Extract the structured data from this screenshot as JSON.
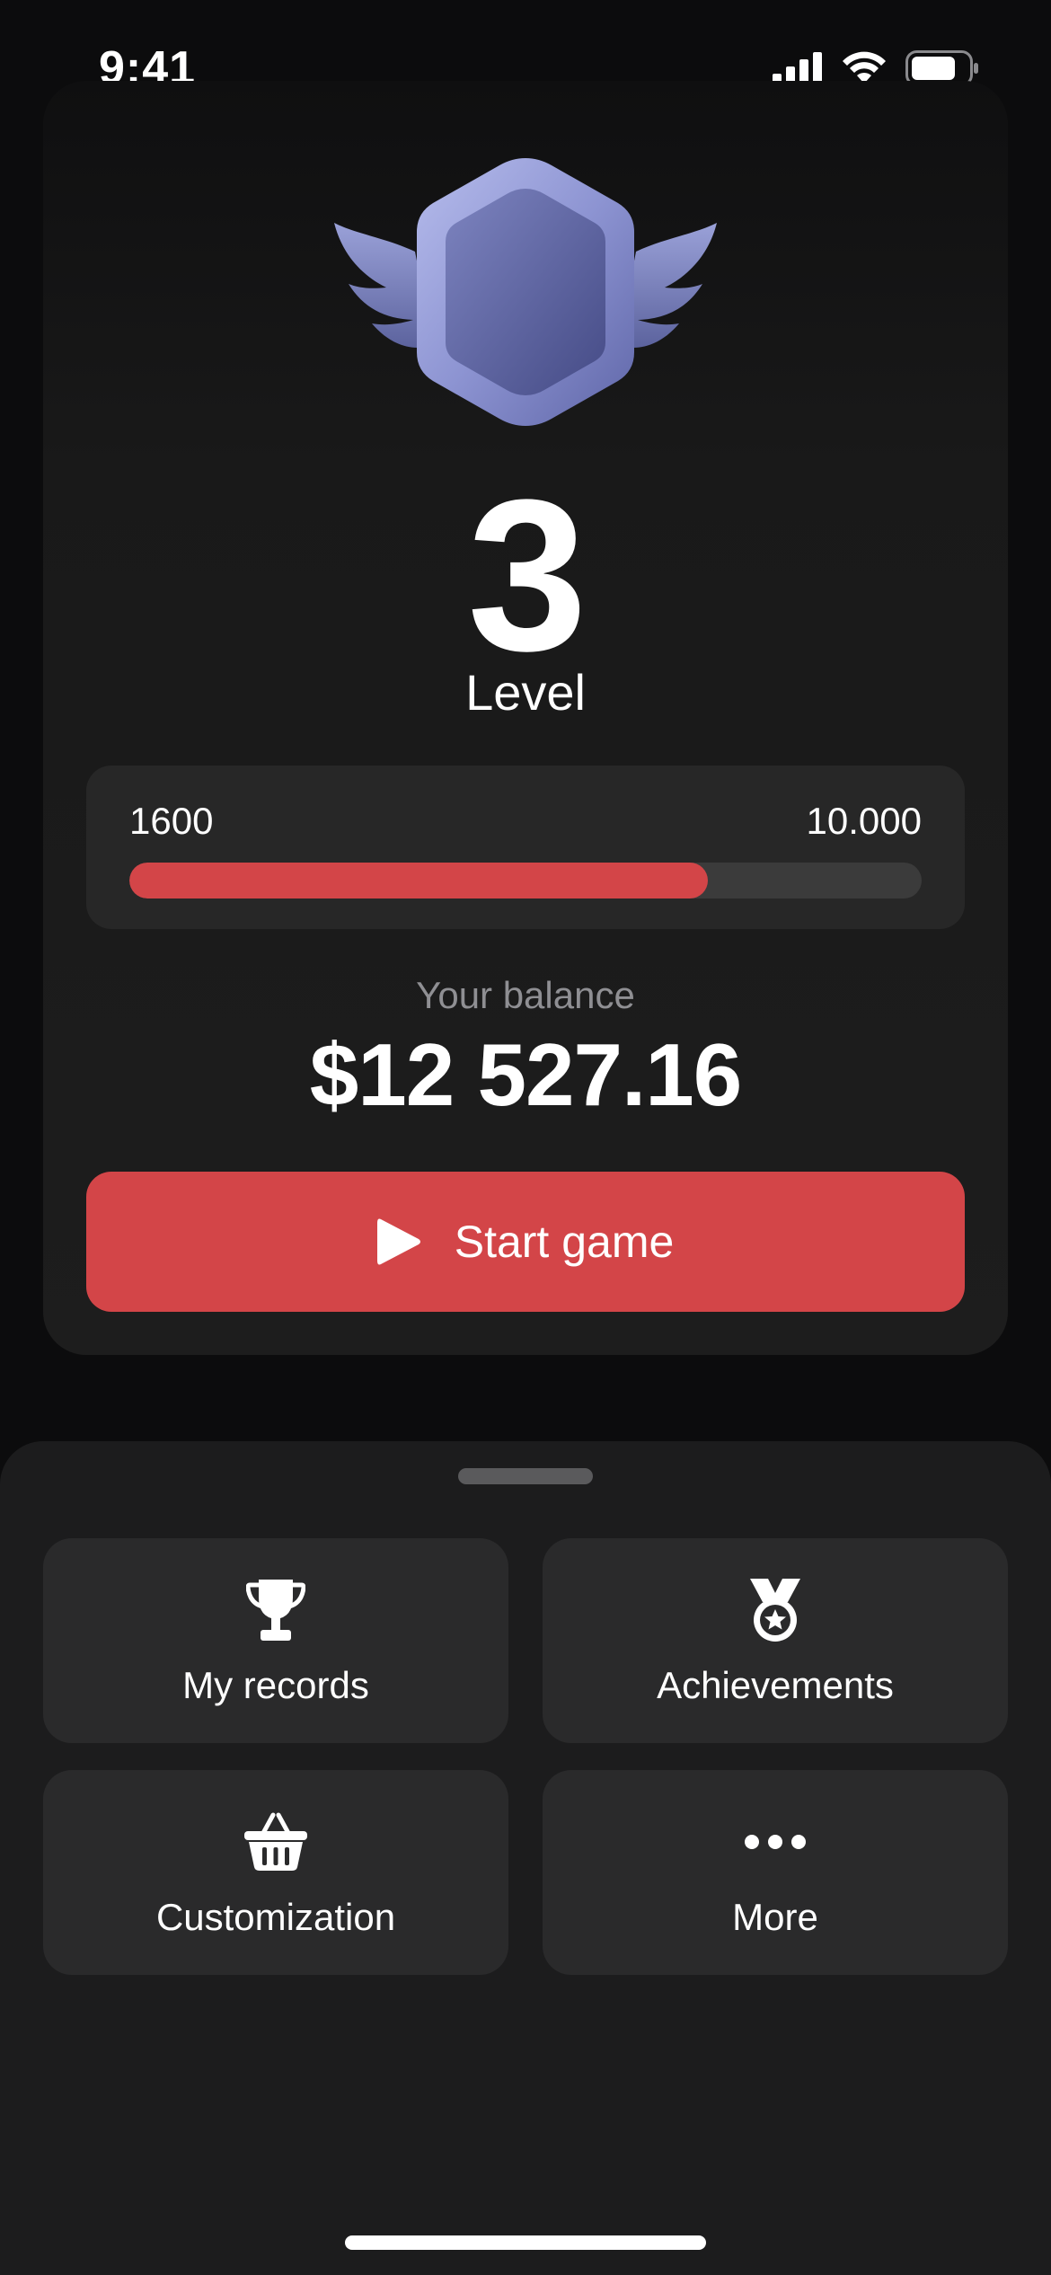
{
  "status_bar": {
    "time": "9:41",
    "icons": [
      "cellular-signal-icon",
      "wifi-icon",
      "battery-icon"
    ]
  },
  "level": {
    "number": "3",
    "label": "Level",
    "badge_icon": "winged-hexagon-badge-icon"
  },
  "progress": {
    "min_label": "1600",
    "max_label": "10.000",
    "fraction": 0.73
  },
  "balance": {
    "label": "Your balance",
    "value": "$12 527.16"
  },
  "start_button": {
    "label": "Start game",
    "icon": "play-icon"
  },
  "menu": {
    "tiles": [
      {
        "label": "My records",
        "icon": "trophy-icon"
      },
      {
        "label": "Achievements",
        "icon": "medal-icon"
      },
      {
        "label": "Customization",
        "icon": "basket-icon"
      },
      {
        "label": "More",
        "icon": "more-dots-icon"
      }
    ]
  },
  "colors": {
    "accent": "#d34548",
    "background": "#0c0c0d",
    "card": "#2a2a2b",
    "badge": "#7f86c4"
  }
}
